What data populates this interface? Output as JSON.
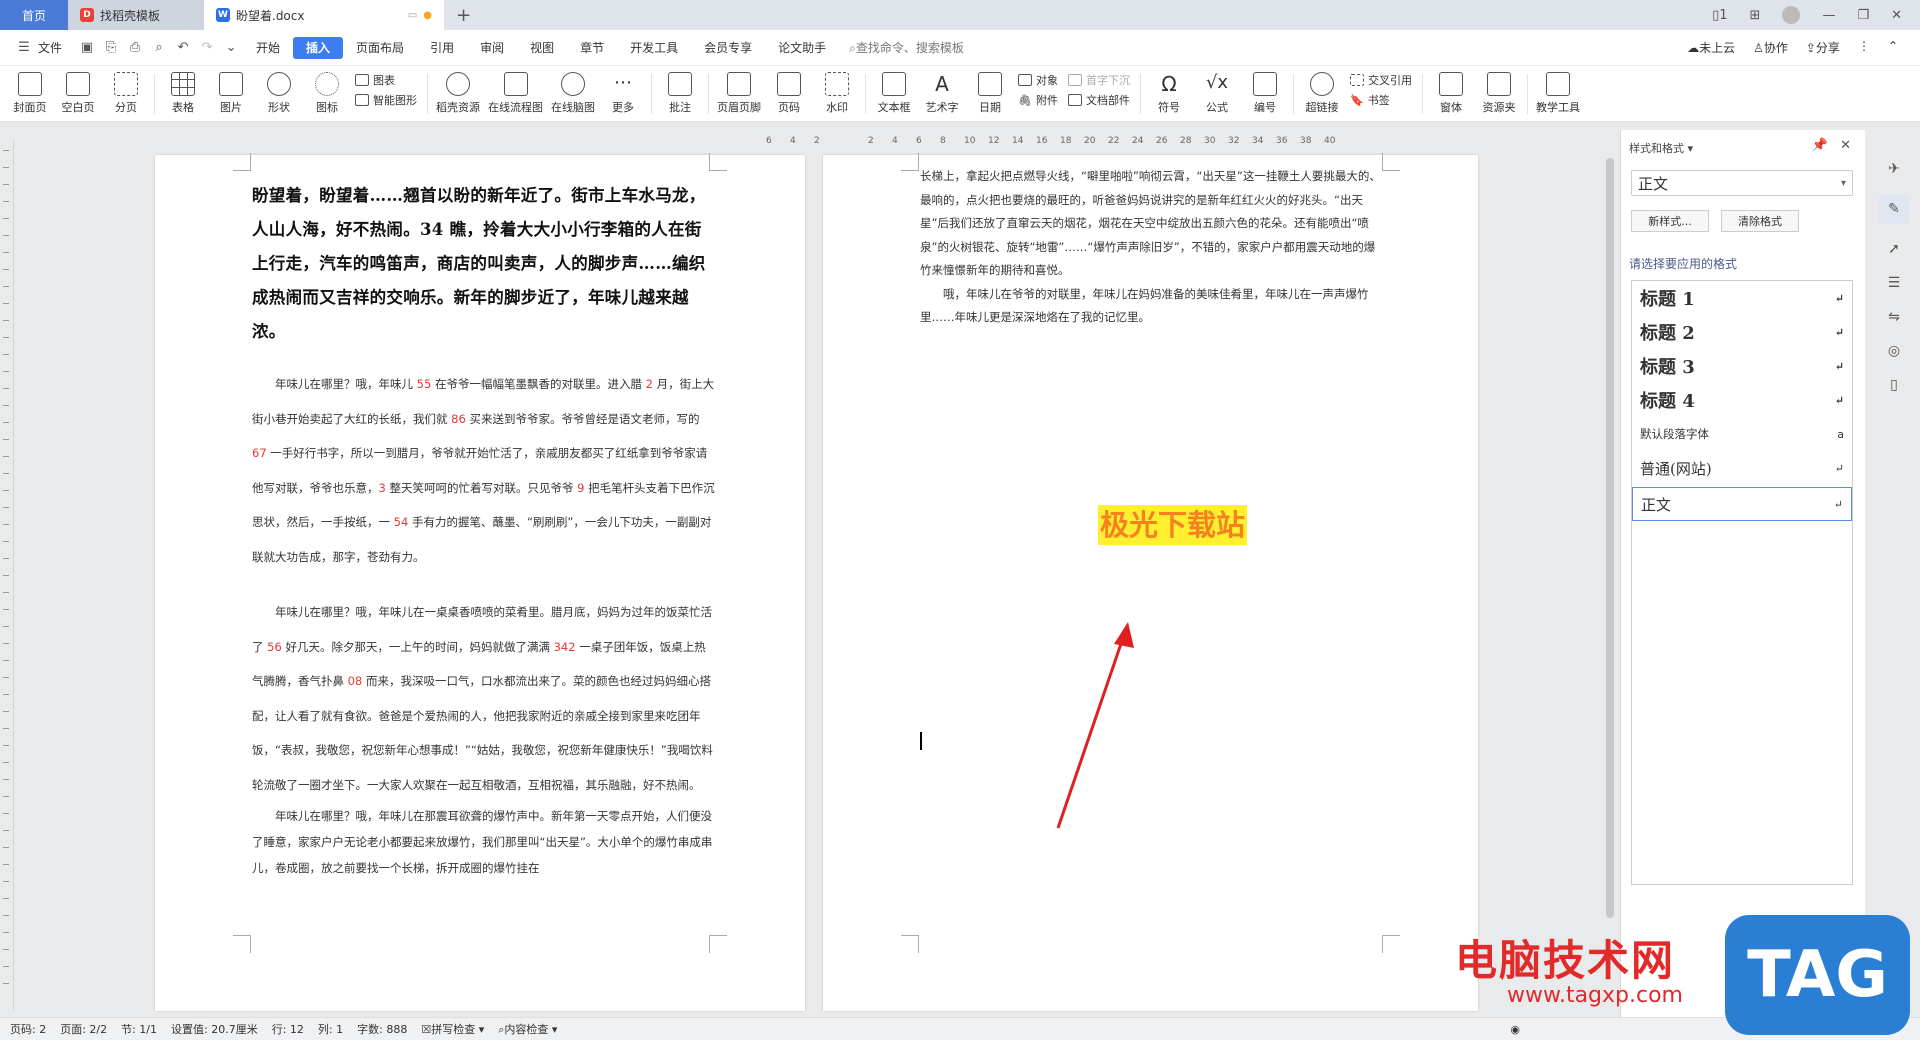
{
  "titlebar": {
    "tabs": [
      {
        "label": "首页"
      },
      {
        "label": "找稻壳模板"
      },
      {
        "label": "盼望着.docx"
      }
    ],
    "new_tab": "+",
    "controls": [
      "1",
      "minimize",
      "restore",
      "close"
    ]
  },
  "menu": {
    "file": "文件",
    "items": [
      "开始",
      "插入",
      "页面布局",
      "引用",
      "审阅",
      "视图",
      "章节",
      "开发工具",
      "会员专享",
      "论文助手"
    ],
    "active": "插入",
    "search": "查找命令、搜索模板",
    "right": [
      "未上云",
      "协作",
      "分享"
    ]
  },
  "toolbar": {
    "big": [
      {
        "label": "封面页"
      },
      {
        "label": "空白页"
      },
      {
        "label": "分页"
      },
      {
        "label": "表格"
      },
      {
        "label": "图片"
      },
      {
        "label": "形状"
      },
      {
        "label": "图标"
      }
    ],
    "chart_group": [
      "图表",
      "智能图形"
    ],
    "big2": [
      {
        "label": "稻壳资源"
      },
      {
        "label": "在线流程图"
      },
      {
        "label": "在线脑图"
      },
      {
        "label": "更多"
      },
      {
        "label": "批注"
      },
      {
        "label": "页眉页脚"
      },
      {
        "label": "页码"
      },
      {
        "label": "水印"
      },
      {
        "label": "文本框"
      },
      {
        "label": "艺术字"
      },
      {
        "label": "日期"
      }
    ],
    "obj_group": [
      "对象",
      "附件"
    ],
    "dropcap_group": [
      "首字下沉",
      "文档部件"
    ],
    "big3": [
      {
        "label": "符号"
      },
      {
        "label": "公式"
      },
      {
        "label": "编号"
      },
      {
        "label": "超链接"
      }
    ],
    "ref_group": [
      "交叉引用",
      "书签"
    ],
    "big4": [
      {
        "label": "窗体"
      },
      {
        "label": "资源夹"
      },
      {
        "label": "教学工具"
      }
    ]
  },
  "ruler": {
    "h_marks": [
      "6",
      "4",
      "2",
      "2",
      "4",
      "6",
      "8",
      "10",
      "12",
      "14",
      "16",
      "18",
      "20",
      "22",
      "24",
      "26",
      "28",
      "30",
      "32",
      "34",
      "36",
      "38",
      "40"
    ]
  },
  "page1": {
    "heading": "盼望着，盼望着……翘首以盼的新年近了。街市上车水马龙，人山人海，好不热闹。34 瞧，拎着大大小小行李箱的人在街上行走，汽车的鸣笛声，商店的叫卖声，人的脚步声……编织成热闹而又吉祥的交响乐。新年的脚步近了，年味儿越来越浓。",
    "para1": [
      {
        "t": "年味儿在哪里？哦，年味儿 "
      },
      {
        "t": "55",
        "r": true
      },
      {
        "t": " 在爷爷一幅幅笔墨飘香的对联里。进入腊 "
      },
      {
        "t": "2",
        "r": true
      },
      {
        "t": " 月，街上大街小巷开始卖起了大红的长纸，我们就 "
      },
      {
        "t": "86",
        "r": true
      },
      {
        "t": " 买来送到爷爷家。爷爷曾经是语文老师，写的 "
      },
      {
        "t": "67",
        "r": true
      },
      {
        "t": " 一手好行书字，所以一到腊月，爷爷就开始忙活了，亲戚朋友都买了红纸拿到爷爷家请他写对联，爷爷也乐意，"
      },
      {
        "t": "3",
        "r": true
      },
      {
        "t": " 整天笑呵呵的忙着写对联。只见爷爷 "
      },
      {
        "t": "9",
        "r": true
      },
      {
        "t": " 把毛笔杆头支着下巴作沉思状，然后，一手按纸，一 "
      },
      {
        "t": "54",
        "r": true
      },
      {
        "t": " 手有力的握笔、蘸墨、“刷刷刷”，一会儿下功夫，一副副对联就大功告成，那字，苍劲有力。"
      }
    ],
    "para2": [
      {
        "t": "年味儿在哪里？哦，年味儿在一桌桌香喷喷的菜肴里。腊月底，妈妈为过年的饭菜忙活了 "
      },
      {
        "t": "56",
        "r": true
      },
      {
        "t": " 好几天。除夕那天，一上午的时间，妈妈就做了满满 "
      },
      {
        "t": "342",
        "r": true
      },
      {
        "t": " 一桌子团年饭，饭桌上热气腾腾，香气扑鼻 "
      },
      {
        "t": "08",
        "r": true
      },
      {
        "t": " 而来，我深吸一口气，口水都流出来了。菜的颜色也经过妈妈细心搭配，让人看了就有食欲。爸爸是个爱热闹的人，他把我家附近的亲戚全接到家里来吃团年饭，“表叔，我敬您，祝您新年心想事成！”“姑姑，我敬您，祝您新年健康快乐！”我喝饮料轮流敬了一圈才坐下。一大家人欢聚在一起互相敬酒，互相祝福，其乐融融，好不热闹。"
      }
    ],
    "para3": "年味儿在哪里？哦，年味儿在那震耳欲聋的爆竹声中。新年第一天零点开始，人们便没了睡意，家家户户无论老小都要起来放爆竹，我们那里叫“出天星”。大小单个的爆竹串成串儿，卷成圈，放之前要找一个长梯，拆开成圈的爆竹挂在"
  },
  "page2": {
    "para1": "长梯上，拿起火把点燃导火线，“噼里啪啦”响彻云霄，“出天星”这一挂鞭土人要挑最大的、最响的，点火把也要烧的最旺的，听爸爸妈妈说讲究的是新年红红火火的好兆头。“出天星”后我们还放了直窜云天的烟花，烟花在天空中绽放出五颜六色的花朵。还有能喷出“喷泉”的火树银花、旋转“地雷”……“爆竹声声除旧岁”，不错的，家家户户都用震天动地的爆竹来憧憬新年的期待和喜悦。",
    "para2": "哦，年味儿在爷爷的对联里，年味儿在妈妈准备的美味佳肴里，年味儿在一声声爆竹里……年味儿更是深深地烙在了我的记忆里。",
    "highlight": "极光下载站"
  },
  "panel": {
    "title": "样式和格式",
    "current": "正文",
    "new_style": "新样式...",
    "clear": "清除格式",
    "apply_label": "请选择要应用的格式",
    "styles": [
      {
        "label": "标题  1",
        "kind": "h",
        "mark": "↵"
      },
      {
        "label": "标题  2",
        "kind": "h",
        "mark": "↵"
      },
      {
        "label": "标题  3",
        "kind": "h",
        "mark": "↵"
      },
      {
        "label": "标题  4",
        "kind": "h",
        "mark": "↵"
      },
      {
        "label": "默认段落字体",
        "kind": "sm",
        "mark": "a"
      },
      {
        "label": "普通(网站)",
        "kind": "md",
        "mark": "↵"
      },
      {
        "label": "正文",
        "kind": "md",
        "mark": "↵",
        "selected": true
      }
    ]
  },
  "status": {
    "page_num": "页码: 2",
    "pages": "页面: 2/2",
    "section": "节: 1/1",
    "setting": "设置值: 20.7厘米",
    "row": "行: 12",
    "col": "列: 1",
    "words": "字数: 888",
    "spell": "拼写检查",
    "content": "内容检查"
  },
  "overlay_watermark": {
    "cn": "电脑技术网",
    "url": "www.tagxp.com",
    "tag": "TAG"
  },
  "colors": {
    "accent": "#3c7df0",
    "red_num": "#e53935",
    "highlight_bg": "#ffef2e",
    "highlight_fg": "#f58220",
    "arrow": "#e02020"
  }
}
